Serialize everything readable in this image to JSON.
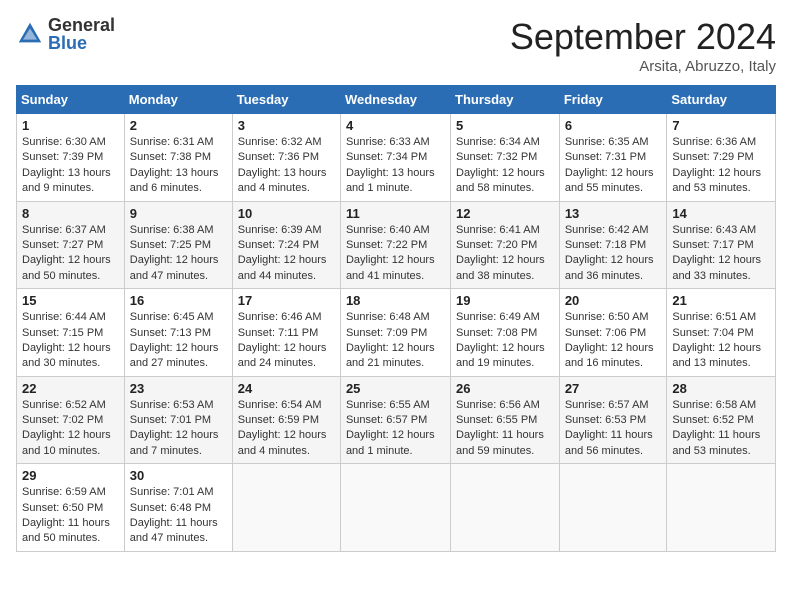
{
  "header": {
    "logo_general": "General",
    "logo_blue": "Blue",
    "month_title": "September 2024",
    "subtitle": "Arsita, Abruzzo, Italy"
  },
  "weekdays": [
    "Sunday",
    "Monday",
    "Tuesday",
    "Wednesday",
    "Thursday",
    "Friday",
    "Saturday"
  ],
  "weeks": [
    [
      {
        "day": "1",
        "sunrise": "Sunrise: 6:30 AM",
        "sunset": "Sunset: 7:39 PM",
        "daylight": "Daylight: 13 hours and 9 minutes."
      },
      {
        "day": "2",
        "sunrise": "Sunrise: 6:31 AM",
        "sunset": "Sunset: 7:38 PM",
        "daylight": "Daylight: 13 hours and 6 minutes."
      },
      {
        "day": "3",
        "sunrise": "Sunrise: 6:32 AM",
        "sunset": "Sunset: 7:36 PM",
        "daylight": "Daylight: 13 hours and 4 minutes."
      },
      {
        "day": "4",
        "sunrise": "Sunrise: 6:33 AM",
        "sunset": "Sunset: 7:34 PM",
        "daylight": "Daylight: 13 hours and 1 minute."
      },
      {
        "day": "5",
        "sunrise": "Sunrise: 6:34 AM",
        "sunset": "Sunset: 7:32 PM",
        "daylight": "Daylight: 12 hours and 58 minutes."
      },
      {
        "day": "6",
        "sunrise": "Sunrise: 6:35 AM",
        "sunset": "Sunset: 7:31 PM",
        "daylight": "Daylight: 12 hours and 55 minutes."
      },
      {
        "day": "7",
        "sunrise": "Sunrise: 6:36 AM",
        "sunset": "Sunset: 7:29 PM",
        "daylight": "Daylight: 12 hours and 53 minutes."
      }
    ],
    [
      {
        "day": "8",
        "sunrise": "Sunrise: 6:37 AM",
        "sunset": "Sunset: 7:27 PM",
        "daylight": "Daylight: 12 hours and 50 minutes."
      },
      {
        "day": "9",
        "sunrise": "Sunrise: 6:38 AM",
        "sunset": "Sunset: 7:25 PM",
        "daylight": "Daylight: 12 hours and 47 minutes."
      },
      {
        "day": "10",
        "sunrise": "Sunrise: 6:39 AM",
        "sunset": "Sunset: 7:24 PM",
        "daylight": "Daylight: 12 hours and 44 minutes."
      },
      {
        "day": "11",
        "sunrise": "Sunrise: 6:40 AM",
        "sunset": "Sunset: 7:22 PM",
        "daylight": "Daylight: 12 hours and 41 minutes."
      },
      {
        "day": "12",
        "sunrise": "Sunrise: 6:41 AM",
        "sunset": "Sunset: 7:20 PM",
        "daylight": "Daylight: 12 hours and 38 minutes."
      },
      {
        "day": "13",
        "sunrise": "Sunrise: 6:42 AM",
        "sunset": "Sunset: 7:18 PM",
        "daylight": "Daylight: 12 hours and 36 minutes."
      },
      {
        "day": "14",
        "sunrise": "Sunrise: 6:43 AM",
        "sunset": "Sunset: 7:17 PM",
        "daylight": "Daylight: 12 hours and 33 minutes."
      }
    ],
    [
      {
        "day": "15",
        "sunrise": "Sunrise: 6:44 AM",
        "sunset": "Sunset: 7:15 PM",
        "daylight": "Daylight: 12 hours and 30 minutes."
      },
      {
        "day": "16",
        "sunrise": "Sunrise: 6:45 AM",
        "sunset": "Sunset: 7:13 PM",
        "daylight": "Daylight: 12 hours and 27 minutes."
      },
      {
        "day": "17",
        "sunrise": "Sunrise: 6:46 AM",
        "sunset": "Sunset: 7:11 PM",
        "daylight": "Daylight: 12 hours and 24 minutes."
      },
      {
        "day": "18",
        "sunrise": "Sunrise: 6:48 AM",
        "sunset": "Sunset: 7:09 PM",
        "daylight": "Daylight: 12 hours and 21 minutes."
      },
      {
        "day": "19",
        "sunrise": "Sunrise: 6:49 AM",
        "sunset": "Sunset: 7:08 PM",
        "daylight": "Daylight: 12 hours and 19 minutes."
      },
      {
        "day": "20",
        "sunrise": "Sunrise: 6:50 AM",
        "sunset": "Sunset: 7:06 PM",
        "daylight": "Daylight: 12 hours and 16 minutes."
      },
      {
        "day": "21",
        "sunrise": "Sunrise: 6:51 AM",
        "sunset": "Sunset: 7:04 PM",
        "daylight": "Daylight: 12 hours and 13 minutes."
      }
    ],
    [
      {
        "day": "22",
        "sunrise": "Sunrise: 6:52 AM",
        "sunset": "Sunset: 7:02 PM",
        "daylight": "Daylight: 12 hours and 10 minutes."
      },
      {
        "day": "23",
        "sunrise": "Sunrise: 6:53 AM",
        "sunset": "Sunset: 7:01 PM",
        "daylight": "Daylight: 12 hours and 7 minutes."
      },
      {
        "day": "24",
        "sunrise": "Sunrise: 6:54 AM",
        "sunset": "Sunset: 6:59 PM",
        "daylight": "Daylight: 12 hours and 4 minutes."
      },
      {
        "day": "25",
        "sunrise": "Sunrise: 6:55 AM",
        "sunset": "Sunset: 6:57 PM",
        "daylight": "Daylight: 12 hours and 1 minute."
      },
      {
        "day": "26",
        "sunrise": "Sunrise: 6:56 AM",
        "sunset": "Sunset: 6:55 PM",
        "daylight": "Daylight: 11 hours and 59 minutes."
      },
      {
        "day": "27",
        "sunrise": "Sunrise: 6:57 AM",
        "sunset": "Sunset: 6:53 PM",
        "daylight": "Daylight: 11 hours and 56 minutes."
      },
      {
        "day": "28",
        "sunrise": "Sunrise: 6:58 AM",
        "sunset": "Sunset: 6:52 PM",
        "daylight": "Daylight: 11 hours and 53 minutes."
      }
    ],
    [
      {
        "day": "29",
        "sunrise": "Sunrise: 6:59 AM",
        "sunset": "Sunset: 6:50 PM",
        "daylight": "Daylight: 11 hours and 50 minutes."
      },
      {
        "day": "30",
        "sunrise": "Sunrise: 7:01 AM",
        "sunset": "Sunset: 6:48 PM",
        "daylight": "Daylight: 11 hours and 47 minutes."
      },
      null,
      null,
      null,
      null,
      null
    ]
  ]
}
